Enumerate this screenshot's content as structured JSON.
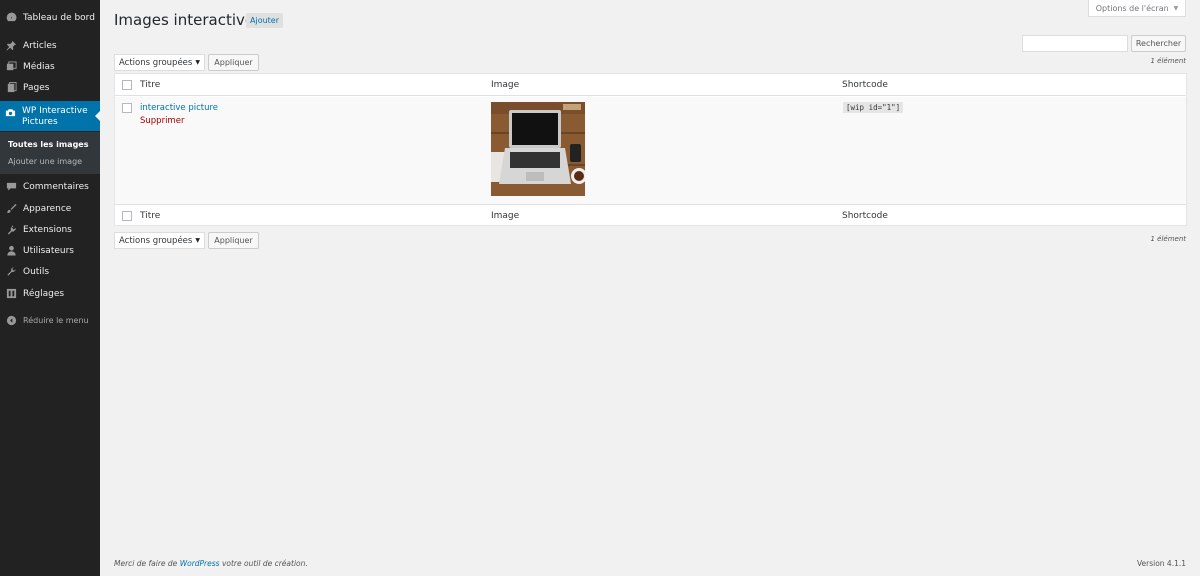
{
  "sidebar": {
    "items": [
      {
        "label": "Tableau de bord",
        "icon": "dashboard-icon"
      },
      {
        "label": "Articles",
        "icon": "pin-icon"
      },
      {
        "label": "Médias",
        "icon": "media-icon"
      },
      {
        "label": "Pages",
        "icon": "pages-icon"
      },
      {
        "label": "WP Interactive Pictures",
        "icon": "image-icon"
      },
      {
        "label": "Commentaires",
        "icon": "comment-icon"
      },
      {
        "label": "Apparence",
        "icon": "brush-icon"
      },
      {
        "label": "Extensions",
        "icon": "plugin-icon"
      },
      {
        "label": "Utilisateurs",
        "icon": "user-icon"
      },
      {
        "label": "Outils",
        "icon": "wrench-icon"
      },
      {
        "label": "Réglages",
        "icon": "settings-icon"
      },
      {
        "label": "Réduire le menu",
        "icon": "collapse-icon"
      }
    ],
    "submenu": [
      {
        "label": "Toutes les images"
      },
      {
        "label": "Ajouter une image"
      }
    ]
  },
  "header": {
    "title": "Images interactives",
    "add_label": "Ajouter",
    "screen_options": "Options de l'écran"
  },
  "search": {
    "value": "",
    "button": "Rechercher"
  },
  "bulk": {
    "select_label": "Actions groupées",
    "apply_label": "Appliquer",
    "count": "1 élément"
  },
  "table": {
    "columns": [
      "Titre",
      "Image",
      "Shortcode"
    ],
    "rows": [
      {
        "title": "interactive picture",
        "delete": "Supprimer",
        "shortcode": "[wip id=\"1\"]"
      }
    ]
  },
  "footer": {
    "prefix": "Merci de faire de ",
    "link": "WordPress",
    "suffix": " votre outil de création.",
    "version": "Version 4.1.1"
  },
  "colors": {
    "sidebar_bg": "#222222",
    "active_bg": "#0073aa",
    "link": "#0073aa",
    "delete": "#aa0000"
  }
}
